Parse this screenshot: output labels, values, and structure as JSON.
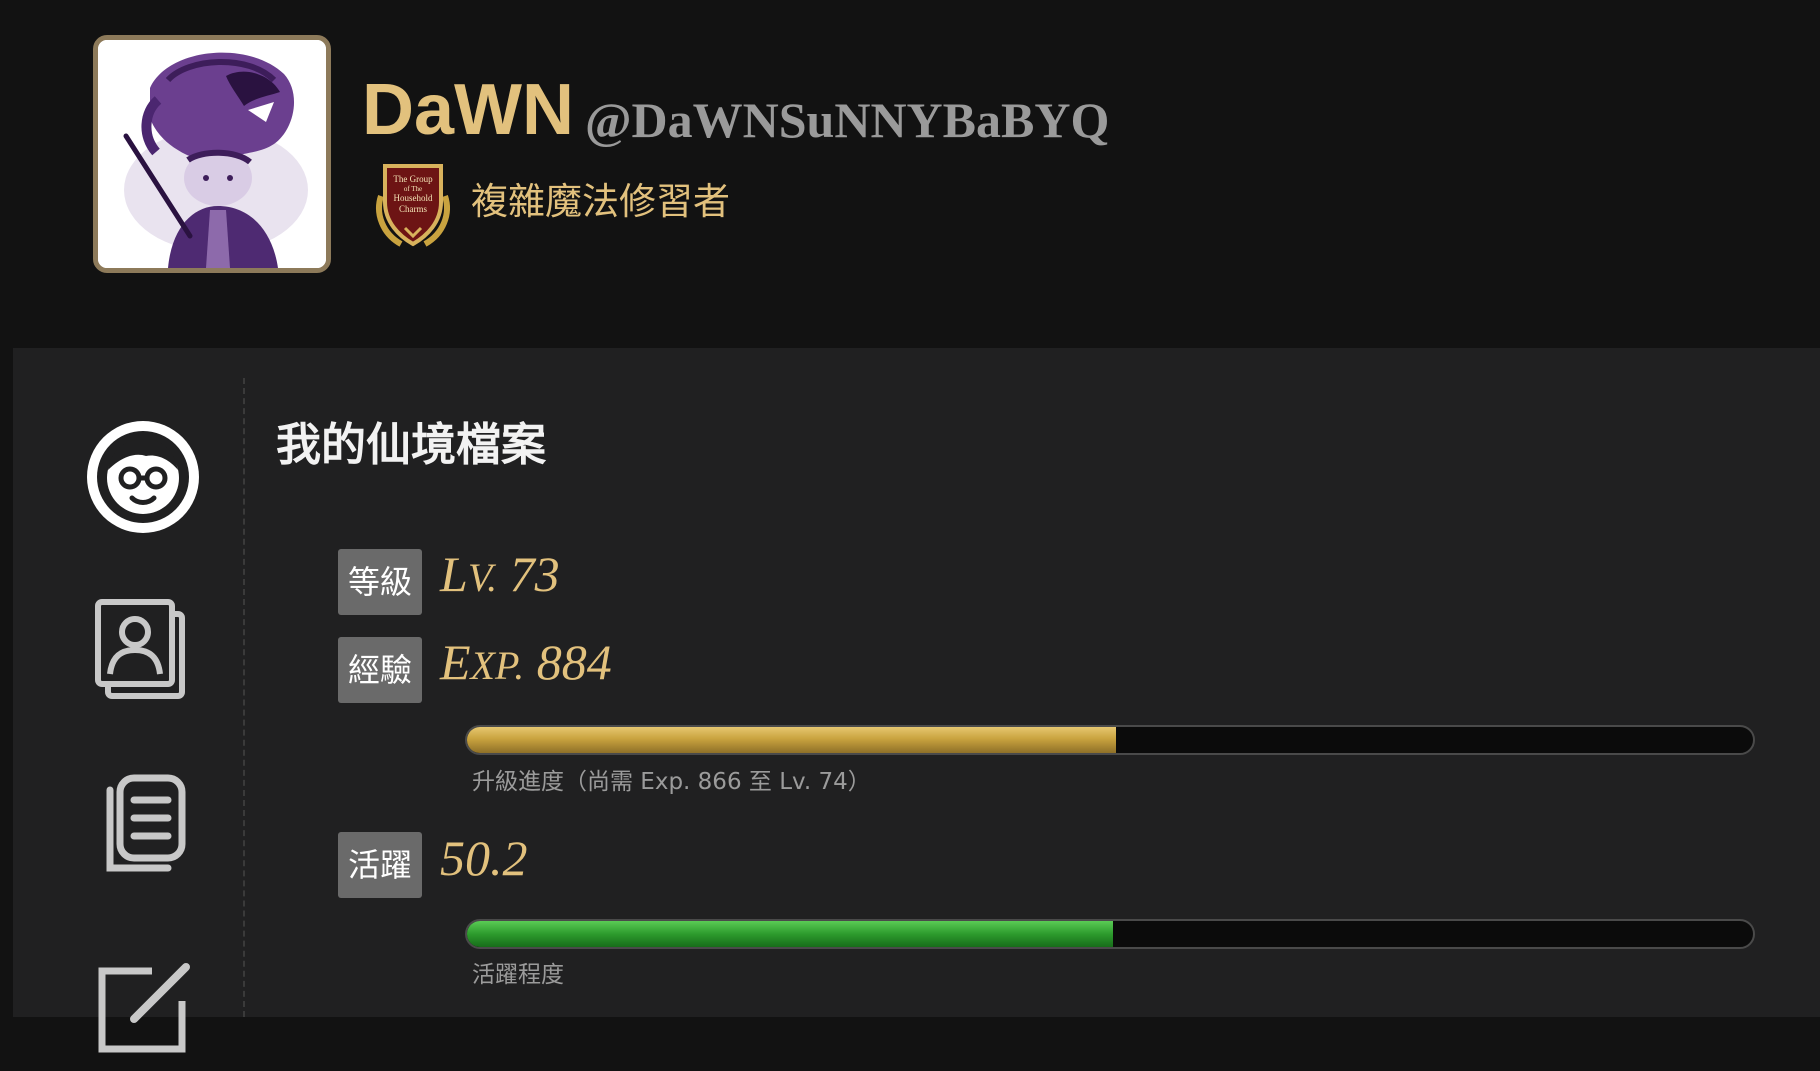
{
  "profile": {
    "display_name": "DaWN",
    "handle": "@DaWNSuNNYBaBYQ",
    "rank_title": "複雜魔法修習者",
    "badge": {
      "icon": "household-charms-crest-icon",
      "lines": [
        "The Group",
        "of The",
        "Household",
        "Charms"
      ]
    },
    "avatar": "wizard-lion-hat-avatar"
  },
  "sidebar": {
    "items": [
      {
        "icon": "profile-face-icon"
      },
      {
        "icon": "profile-cards-icon"
      },
      {
        "icon": "document-icon"
      },
      {
        "icon": "edit-icon"
      }
    ]
  },
  "section": {
    "title": "我的仙境檔案"
  },
  "stats": {
    "level": {
      "label": "等級",
      "prefix": "L",
      "prefix_small": "V.",
      "value": "73"
    },
    "exp": {
      "label": "經驗",
      "prefix": "E",
      "prefix_small": "XP.",
      "value": "884",
      "progress": 0.505,
      "caption": "升級進度（尚需 Exp. 866 至 Lv. 74）"
    },
    "activity": {
      "label": "活躍",
      "value": "50.2",
      "progress": 0.502,
      "caption": "活躍程度"
    }
  },
  "colors": {
    "accent_gold": "#e2c17d",
    "exp_bar": "#c9a33f",
    "activity_bar": "#2d9b2d",
    "panel_bg": "#202021",
    "page_bg": "#121212"
  }
}
